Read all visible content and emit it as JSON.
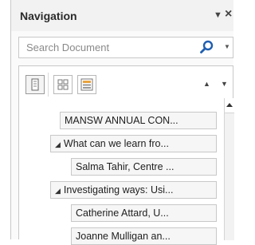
{
  "pane": {
    "title": "Navigation",
    "menu_arrow": "▼",
    "close": "×"
  },
  "search": {
    "placeholder": "Search Document",
    "dropdown_arrow": "▼"
  },
  "tabs": [
    {
      "name": "headings",
      "active": true
    },
    {
      "name": "pages",
      "active": false
    },
    {
      "name": "results",
      "active": false
    }
  ],
  "nav_arrows": {
    "up": "▲",
    "down": "▼"
  },
  "headings": [
    {
      "label": "MANSW ANNUAL CON...",
      "level": 1,
      "expanded": null
    },
    {
      "label": "What can we learn fro...",
      "level": 1,
      "expanded": true
    },
    {
      "label": "Salma Tahir, Centre ...",
      "level": 2,
      "expanded": null
    },
    {
      "label": "Investigating ways: Usi...",
      "level": 1,
      "expanded": true
    },
    {
      "label": "Catherine Attard, U...",
      "level": 2,
      "expanded": null
    },
    {
      "label": "Joanne Mulligan an...",
      "level": 2,
      "expanded": null
    }
  ],
  "colors": {
    "pane_bg": "#fafafa",
    "item_bg": "#f6f6f6",
    "border": "#c8c8c8",
    "search_icon": "#1f5fb0"
  }
}
